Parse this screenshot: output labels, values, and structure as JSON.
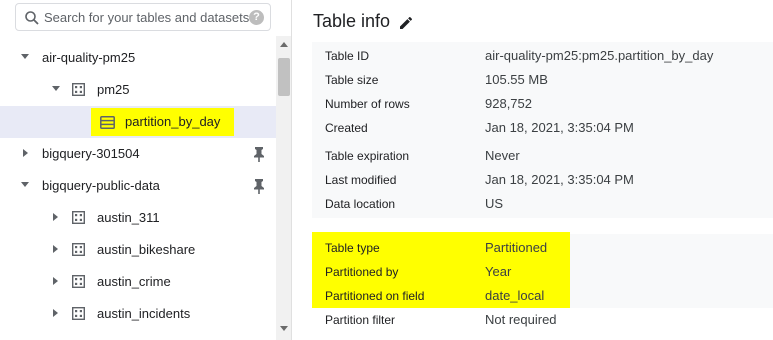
{
  "search": {
    "placeholder": "Search for your tables and datasets",
    "icon": "search-icon",
    "help_icon": "help-icon"
  },
  "tree": {
    "items": [
      {
        "label": "air-quality-pm25",
        "expanded": true,
        "pinned": false
      },
      {
        "label": "pm25",
        "expanded": true
      },
      {
        "label": "partition_by_day",
        "selected": true
      },
      {
        "label": "bigquery-301504",
        "expanded": false,
        "pinned": true
      },
      {
        "label": "bigquery-public-data",
        "expanded": true,
        "pinned": true
      },
      {
        "label": "austin_311",
        "expanded": false
      },
      {
        "label": "austin_bikeshare",
        "expanded": false
      },
      {
        "label": "austin_crime",
        "expanded": false
      },
      {
        "label": "austin_incidents",
        "expanded": false
      }
    ]
  },
  "details": {
    "title": "Table info",
    "rows": [
      {
        "key": "Table ID",
        "value": "air-quality-pm25:pm25.partition_by_day"
      },
      {
        "key": "Table size",
        "value": "105.55 MB"
      },
      {
        "key": "Number of rows",
        "value": "928,752"
      },
      {
        "key": "Created",
        "value": "Jan 18, 2021, 3:35:04 PM"
      },
      {
        "key": "Table expiration",
        "value": "Never"
      },
      {
        "key": "Last modified",
        "value": "Jan 18, 2021, 3:35:04 PM"
      },
      {
        "key": "Data location",
        "value": "US"
      },
      {
        "key": "Table type",
        "value": "Partitioned"
      },
      {
        "key": "Partitioned by",
        "value": "Year"
      },
      {
        "key": "Partitioned on field",
        "value": "date_local"
      },
      {
        "key": "Partition filter",
        "value": "Not required"
      }
    ]
  },
  "colors": {
    "highlight": "#ffff00",
    "selected_row": "#e8eaf6",
    "info_bg": "#f8f9fa"
  }
}
